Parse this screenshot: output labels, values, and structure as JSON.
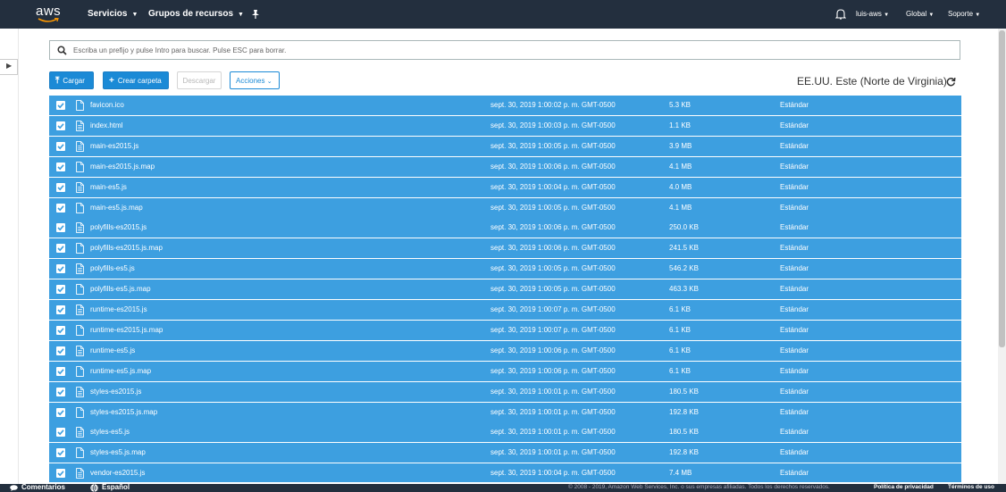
{
  "topnav": {
    "logo": "aws",
    "services": "Servicios",
    "resource_groups": "Grupos de recursos",
    "user": "luis-aws",
    "region": "Global",
    "support": "Soporte"
  },
  "search": {
    "placeholder": "Escriba un prefijo y pulse Intro para buscar. Pulse ESC para borrar."
  },
  "toolbar": {
    "upload": "Cargar",
    "create_folder": "Crear carpeta",
    "download": "Descargar",
    "actions": "Acciones",
    "region": "EE.UU. Este (Norte de Virginia)"
  },
  "colors": {
    "nav_bg": "#232f3e",
    "row_selected": "#3d9fe0",
    "primary": "#1b8ad6"
  },
  "files": [
    {
      "name": "favicon.ico",
      "icon": "file-icon",
      "date": "sept. 30, 2019 1:00:02 p. m. GMT-0500",
      "size": "5.3 KB",
      "class": "Estándar"
    },
    {
      "name": "index.html",
      "icon": "document-icon",
      "date": "sept. 30, 2019 1:00:03 p. m. GMT-0500",
      "size": "1.1 KB",
      "class": "Estándar"
    },
    {
      "name": "main-es2015.js",
      "icon": "document-icon",
      "date": "sept. 30, 2019 1:00:05 p. m. GMT-0500",
      "size": "3.9 MB",
      "class": "Estándar"
    },
    {
      "name": "main-es2015.js.map",
      "icon": "file-icon",
      "date": "sept. 30, 2019 1:00:06 p. m. GMT-0500",
      "size": "4.1 MB",
      "class": "Estándar"
    },
    {
      "name": "main-es5.js",
      "icon": "document-icon",
      "date": "sept. 30, 2019 1:00:04 p. m. GMT-0500",
      "size": "4.0 MB",
      "class": "Estándar"
    },
    {
      "name": "main-es5.js.map",
      "icon": "file-icon",
      "date": "sept. 30, 2019 1:00:05 p. m. GMT-0500",
      "size": "4.1 MB",
      "class": "Estándar"
    },
    {
      "name": "polyfills-es2015.js",
      "icon": "document-icon",
      "date": "sept. 30, 2019 1:00:06 p. m. GMT-0500",
      "size": "250.0 KB",
      "class": "Estándar"
    },
    {
      "name": "polyfills-es2015.js.map",
      "icon": "file-icon",
      "date": "sept. 30, 2019 1:00:06 p. m. GMT-0500",
      "size": "241.5 KB",
      "class": "Estándar"
    },
    {
      "name": "polyfills-es5.js",
      "icon": "document-icon",
      "date": "sept. 30, 2019 1:00:05 p. m. GMT-0500",
      "size": "546.2 KB",
      "class": "Estándar"
    },
    {
      "name": "polyfills-es5.js.map",
      "icon": "file-icon",
      "date": "sept. 30, 2019 1:00:05 p. m. GMT-0500",
      "size": "463.3 KB",
      "class": "Estándar"
    },
    {
      "name": "runtime-es2015.js",
      "icon": "document-icon",
      "date": "sept. 30, 2019 1:00:07 p. m. GMT-0500",
      "size": "6.1 KB",
      "class": "Estándar"
    },
    {
      "name": "runtime-es2015.js.map",
      "icon": "file-icon",
      "date": "sept. 30, 2019 1:00:07 p. m. GMT-0500",
      "size": "6.1 KB",
      "class": "Estándar"
    },
    {
      "name": "runtime-es5.js",
      "icon": "document-icon",
      "date": "sept. 30, 2019 1:00:06 p. m. GMT-0500",
      "size": "6.1 KB",
      "class": "Estándar"
    },
    {
      "name": "runtime-es5.js.map",
      "icon": "file-icon",
      "date": "sept. 30, 2019 1:00:06 p. m. GMT-0500",
      "size": "6.1 KB",
      "class": "Estándar"
    },
    {
      "name": "styles-es2015.js",
      "icon": "document-icon",
      "date": "sept. 30, 2019 1:00:01 p. m. GMT-0500",
      "size": "180.5 KB",
      "class": "Estándar"
    },
    {
      "name": "styles-es2015.js.map",
      "icon": "file-icon",
      "date": "sept. 30, 2019 1:00:01 p. m. GMT-0500",
      "size": "192.8 KB",
      "class": "Estándar"
    },
    {
      "name": "styles-es5.js",
      "icon": "document-icon",
      "date": "sept. 30, 2019 1:00:01 p. m. GMT-0500",
      "size": "180.5 KB",
      "class": "Estándar"
    },
    {
      "name": "styles-es5.js.map",
      "icon": "file-icon",
      "date": "sept. 30, 2019 1:00:01 p. m. GMT-0500",
      "size": "192.8 KB",
      "class": "Estándar"
    },
    {
      "name": "vendor-es2015.js",
      "icon": "document-icon",
      "date": "sept. 30, 2019 1:00:04 p. m. GMT-0500",
      "size": "7.4 MB",
      "class": "Estándar"
    }
  ],
  "footer": {
    "feedback": "Comentarios",
    "language": "Español",
    "copyright": "© 2008 - 2019, Amazon Web Services, Inc. o sus empresas afiliadas. Todos los derechos reservados.",
    "privacy": "Política de privacidad",
    "terms": "Términos de uso"
  }
}
